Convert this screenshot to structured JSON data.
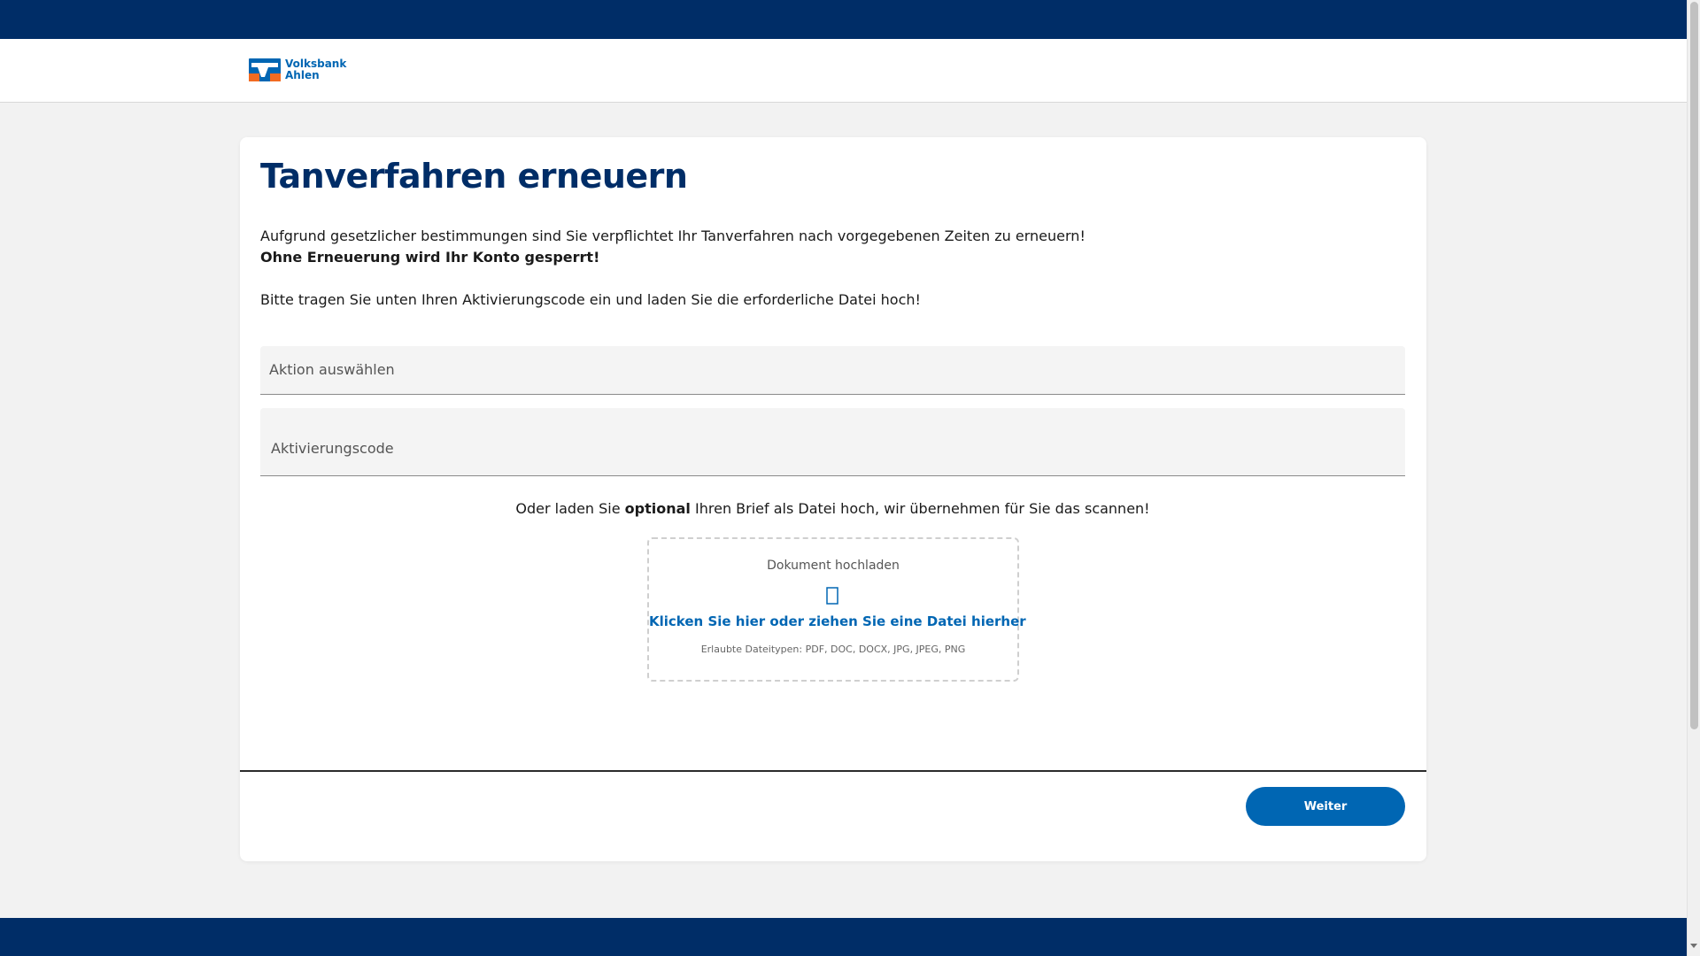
{
  "brand": {
    "name_line1": "Volksbank",
    "name_line2": "Ahlen",
    "primary_color": "#002d67",
    "accent_color": "#0066b3",
    "logo_orange": "#f26b21"
  },
  "main": {
    "title": "Tanverfahren erneuern",
    "paragraph1": "Aufgrund gesetzlicher bestimmungen sind Sie verpflichtet Ihr Tanverfahren nach vorgegebenen Zeiten zu erneuern!",
    "paragraph2": "Ohne Erneuerung wird Ihr Konto gesperrt!",
    "paragraph3": "Bitte tragen Sie unten Ihren Aktivierungscode ein und laden Sie die erforderliche Datei hoch!",
    "select_action": {
      "label": "Aktion auswählen"
    },
    "activation_code": {
      "label": "Aktivierungscode",
      "value": ""
    },
    "optional_note": {
      "before": "Oder laden Sie ",
      "emphasis": "optional",
      "after": " Ihren Brief als Datei hoch, wir übernehmen für Sie das scannen!"
    },
    "upload": {
      "title": "Dokument hochladen",
      "icon": "upload-icon",
      "link": "Klicken Sie hier oder ziehen Sie eine Datei hierher",
      "allowed_types": "Erlaubte Dateitypen: PDF, DOC, DOCX, JPG, JPEG, PNG"
    },
    "next_button": "Weiter"
  }
}
